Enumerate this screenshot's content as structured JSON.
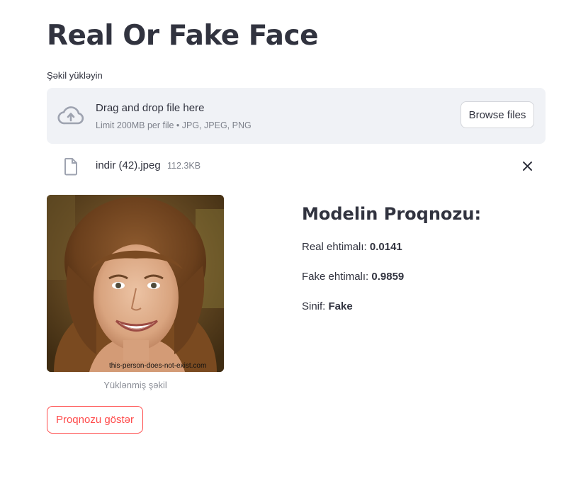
{
  "page": {
    "title": "Real Or Fake Face"
  },
  "uploader": {
    "label": "Şəkil yükləyin",
    "drop_title": "Drag and drop file here",
    "drop_limits": "Limit 200MB per file • JPG, JPEG, PNG",
    "browse_label": "Browse files",
    "icon": "cloud-upload-icon"
  },
  "file": {
    "name": "indir (42).jpeg",
    "size": "112.3KB",
    "icon": "file-icon",
    "remove_icon": "close-icon"
  },
  "image": {
    "watermark": "this-person-does-not-exist.com",
    "caption": "Yüklənmiş şəkil"
  },
  "results": {
    "heading": "Modelin Proqnozu:",
    "real_label": "Real ehtimalı: ",
    "real_value": "0.0141",
    "fake_label": "Fake ehtimalı: ",
    "fake_value": "0.9859",
    "class_label": "Sinif: ",
    "class_value": "Fake"
  },
  "actions": {
    "predict_label": "Proqnozu göstər"
  },
  "colors": {
    "text": "#31333f",
    "muted": "#7e828c",
    "dropzone_bg": "#f0f2f6",
    "accent": "#ff4b4b"
  }
}
